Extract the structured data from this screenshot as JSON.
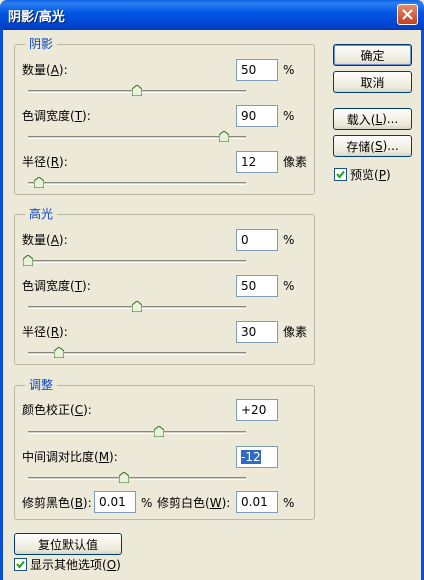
{
  "window": {
    "title": "阴影/高光"
  },
  "shadows": {
    "title": "阴影",
    "amount": {
      "label_pre": "数量(",
      "mnemonic": "A",
      "label_post": "):",
      "value": "50",
      "unit": "%",
      "slider": 0.5
    },
    "tonal_width": {
      "label_pre": "色调宽度(",
      "mnemonic": "T",
      "label_post": "):",
      "value": "90",
      "unit": "%",
      "slider": 0.9
    },
    "radius": {
      "label_pre": "半径(",
      "mnemonic": "R",
      "label_post": "):",
      "value": "12",
      "unit": "像素",
      "slider": 0.05
    }
  },
  "highlights": {
    "title": "高光",
    "amount": {
      "label_pre": "数量(",
      "mnemonic": "A",
      "label_post": "):",
      "value": "0",
      "unit": "%",
      "slider": 0.0
    },
    "tonal_width": {
      "label_pre": "色调宽度(",
      "mnemonic": "T",
      "label_post": "):",
      "value": "50",
      "unit": "%",
      "slider": 0.5
    },
    "radius": {
      "label_pre": "半径(",
      "mnemonic": "R",
      "label_post": "):",
      "value": "30",
      "unit": "像素",
      "slider": 0.14
    }
  },
  "adjustments": {
    "title": "调整",
    "color_correction": {
      "label_pre": "颜色校正(",
      "mnemonic": "C",
      "label_post": "):",
      "value": "+20",
      "slider": 0.6
    },
    "midtone_contrast": {
      "label_pre": "中间调对比度(",
      "mnemonic": "M",
      "label_post": "):",
      "value": "-12",
      "slider": 0.44
    },
    "black_clip": {
      "label_pre": "修剪黑色(",
      "mnemonic": "B",
      "label_post": "):",
      "value": "0.01",
      "unit": "%"
    },
    "white_clip": {
      "label_pre": "修剪白色(",
      "mnemonic": "W",
      "label_post": "):",
      "value": "0.01",
      "unit": "%"
    }
  },
  "buttons": {
    "ok": "确定",
    "cancel": "取消",
    "load": {
      "pre": "载入(",
      "mnemonic": "L",
      "post": ")..."
    },
    "save": {
      "pre": "存储(",
      "mnemonic": "S",
      "post": ")..."
    },
    "reset_defaults": "复位默认值"
  },
  "preview": {
    "pre": "预览(",
    "mnemonic": "P",
    "post": ")",
    "checked": true
  },
  "show_more": {
    "pre": "显示其他选项(",
    "mnemonic": "O",
    "post": ")",
    "checked": true
  }
}
